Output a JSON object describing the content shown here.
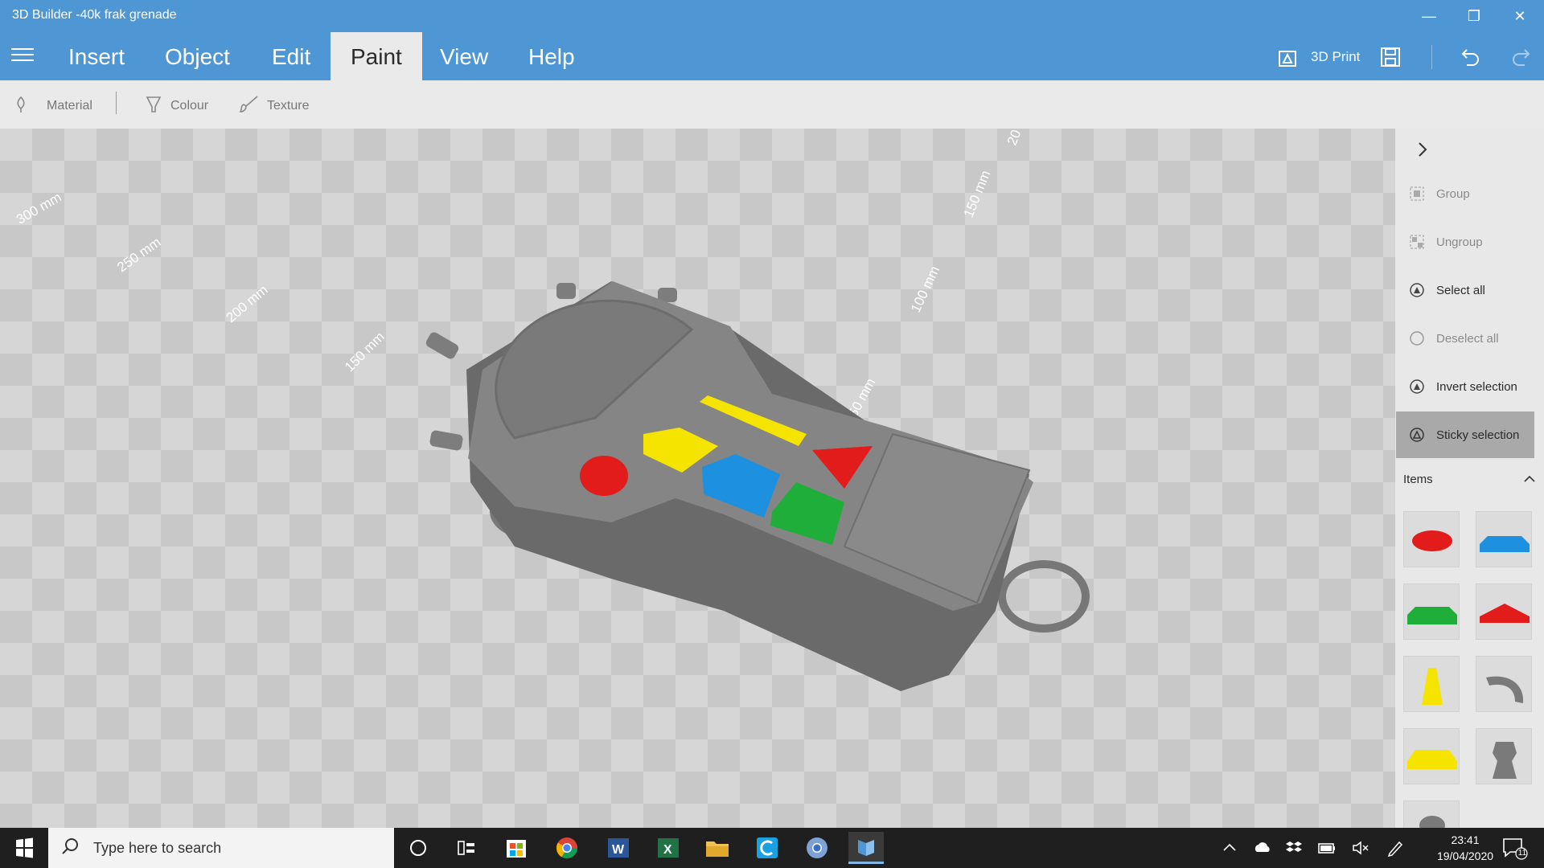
{
  "window": {
    "title": "3D Builder -40k frak grenade",
    "minimize_glyph": "—",
    "maximize_glyph": "❐",
    "close_glyph": "✕"
  },
  "menu": {
    "tabs": [
      {
        "label": "Insert"
      },
      {
        "label": "Object"
      },
      {
        "label": "Edit"
      },
      {
        "label": "Paint",
        "active": true
      },
      {
        "label": "View"
      },
      {
        "label": "Help"
      }
    ],
    "print_label": "3D Print"
  },
  "toolbar": {
    "material_label": "Material",
    "colour_label": "Colour",
    "texture_label": "Texture"
  },
  "viewport": {
    "rulers": [
      "300 mm",
      "250 mm",
      "200 mm",
      "150 mm",
      "50 mm",
      "100 mm",
      "150 mm",
      "20"
    ]
  },
  "panel": {
    "commands": [
      {
        "label": "Group",
        "state": "disabled",
        "icon": "group-icon"
      },
      {
        "label": "Ungroup",
        "state": "disabled",
        "icon": "ungroup-icon"
      },
      {
        "label": "Select all",
        "state": "enabled",
        "icon": "select-all-icon"
      },
      {
        "label": "Deselect all",
        "state": "disabled",
        "icon": "deselect-all-icon"
      },
      {
        "label": "Invert selection",
        "state": "enabled",
        "icon": "invert-selection-icon"
      },
      {
        "label": "Sticky selection",
        "state": "active",
        "icon": "sticky-selection-icon"
      }
    ],
    "items_label": "Items",
    "items": [
      {
        "name": "red-disc",
        "color": "#e21b1b"
      },
      {
        "name": "blue-slab",
        "color": "#1e90e0"
      },
      {
        "name": "green-slab",
        "color": "#1fae3a"
      },
      {
        "name": "red-prism",
        "color": "#e21b1b"
      },
      {
        "name": "yellow-cone",
        "color": "#f5e400"
      },
      {
        "name": "grey-hook",
        "color": "#7a7a7a"
      },
      {
        "name": "yellow-slab",
        "color": "#f5e400"
      },
      {
        "name": "grey-body",
        "color": "#7a7a7a"
      }
    ]
  },
  "taskbar": {
    "search_placeholder": "Type here to search",
    "time": "23:41",
    "date": "19/04/2020",
    "notification_count": "11",
    "colors": {
      "chrome": "#db4437",
      "word": "#2b579a",
      "excel": "#217346",
      "folder": "#f2c14e",
      "cortana": "#1ba1e2"
    }
  }
}
